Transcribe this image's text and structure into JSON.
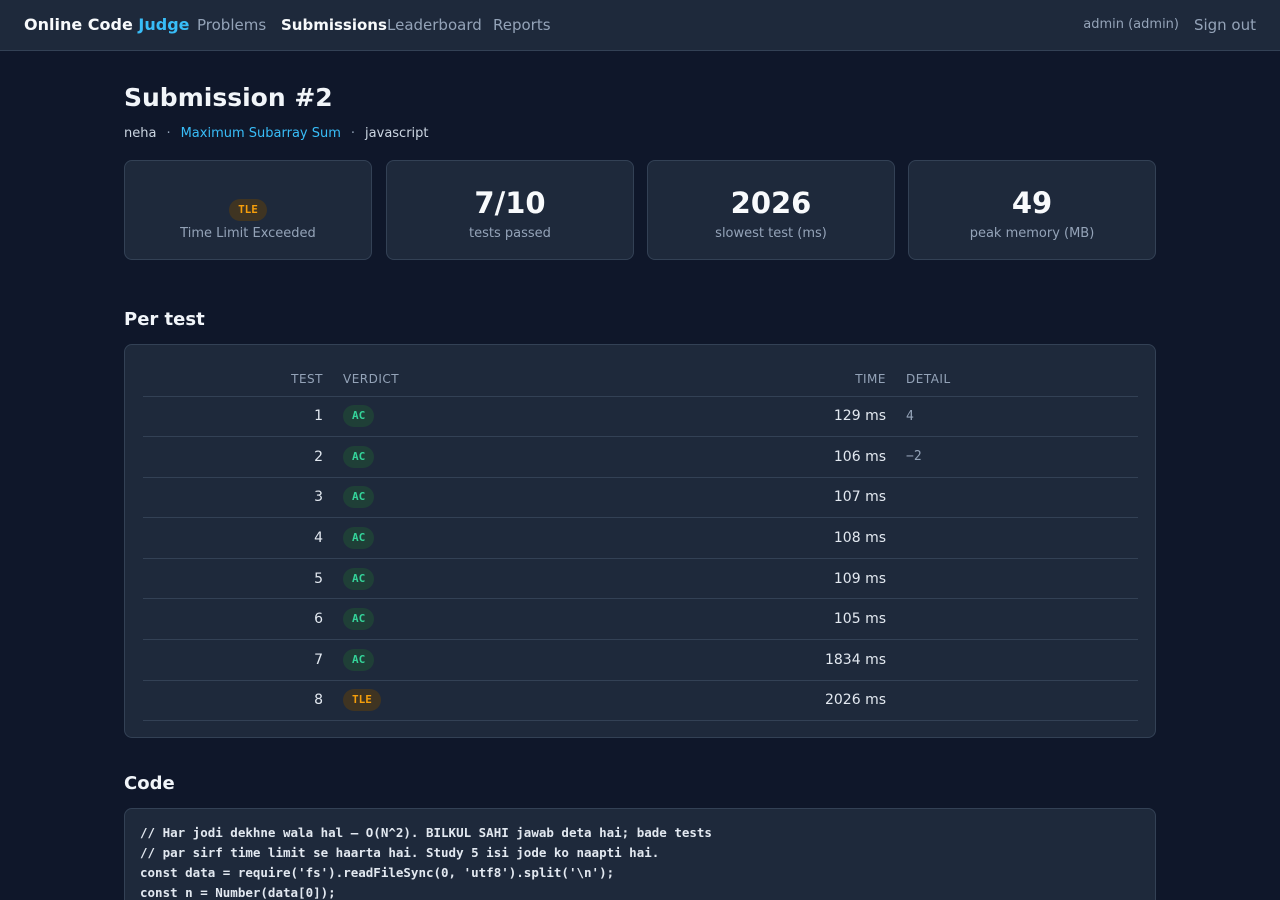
{
  "nav": {
    "brand_main": "Online Code ",
    "brand_accent": "Judge",
    "links": [
      "Problems",
      "Submissions",
      "Leaderboard",
      "Reports"
    ],
    "user": "admin (admin)",
    "signout": "Sign out"
  },
  "submission": {
    "title": "Submission #2",
    "user": "neha",
    "problem": "Maximum Subarray Sum",
    "language": "javascript",
    "separator": "·"
  },
  "stats": {
    "verdict_badge": "TLE",
    "verdict_label": "Time Limit Exceeded",
    "passed_value": "7/10",
    "passed_label": "tests passed",
    "slowest_value": "2026",
    "slowest_label": "slowest test (ms)",
    "memory_value": "49",
    "memory_label": "peak memory (MB)"
  },
  "per_test": {
    "heading": "Per test",
    "columns": [
      "TEST",
      "VERDICT",
      "TIME",
      "DETAIL"
    ],
    "rows": [
      {
        "test": "1",
        "verdict": "AC",
        "time": "129 ms",
        "detail": "4"
      },
      {
        "test": "2",
        "verdict": "AC",
        "time": "106 ms",
        "detail": "−2"
      },
      {
        "test": "3",
        "verdict": "AC",
        "time": "107 ms",
        "detail": ""
      },
      {
        "test": "4",
        "verdict": "AC",
        "time": "108 ms",
        "detail": ""
      },
      {
        "test": "5",
        "verdict": "AC",
        "time": "109 ms",
        "detail": ""
      },
      {
        "test": "6",
        "verdict": "AC",
        "time": "105 ms",
        "detail": ""
      },
      {
        "test": "7",
        "verdict": "AC",
        "time": "1834 ms",
        "detail": ""
      },
      {
        "test": "8",
        "verdict": "TLE",
        "time": "2026 ms",
        "detail": ""
      }
    ]
  },
  "code": {
    "heading": "Code",
    "lines": [
      "// Har jodi dekhne wala hal — O(N^2). BILKUL SAHI jawab deta hai; bade tests",
      "// par sirf time limit se haarta hai. Study 5 isi jode ko naapti hai.",
      "const data = require('fs').readFileSync(0, 'utf8').split('\\n');",
      "const n = Number(data[0]);"
    ]
  },
  "colors": {
    "background": "#0f172a",
    "surface": "#1e293b",
    "accent": "#38bdf8",
    "ac": "#34d399",
    "tle": "#f59e0b"
  }
}
